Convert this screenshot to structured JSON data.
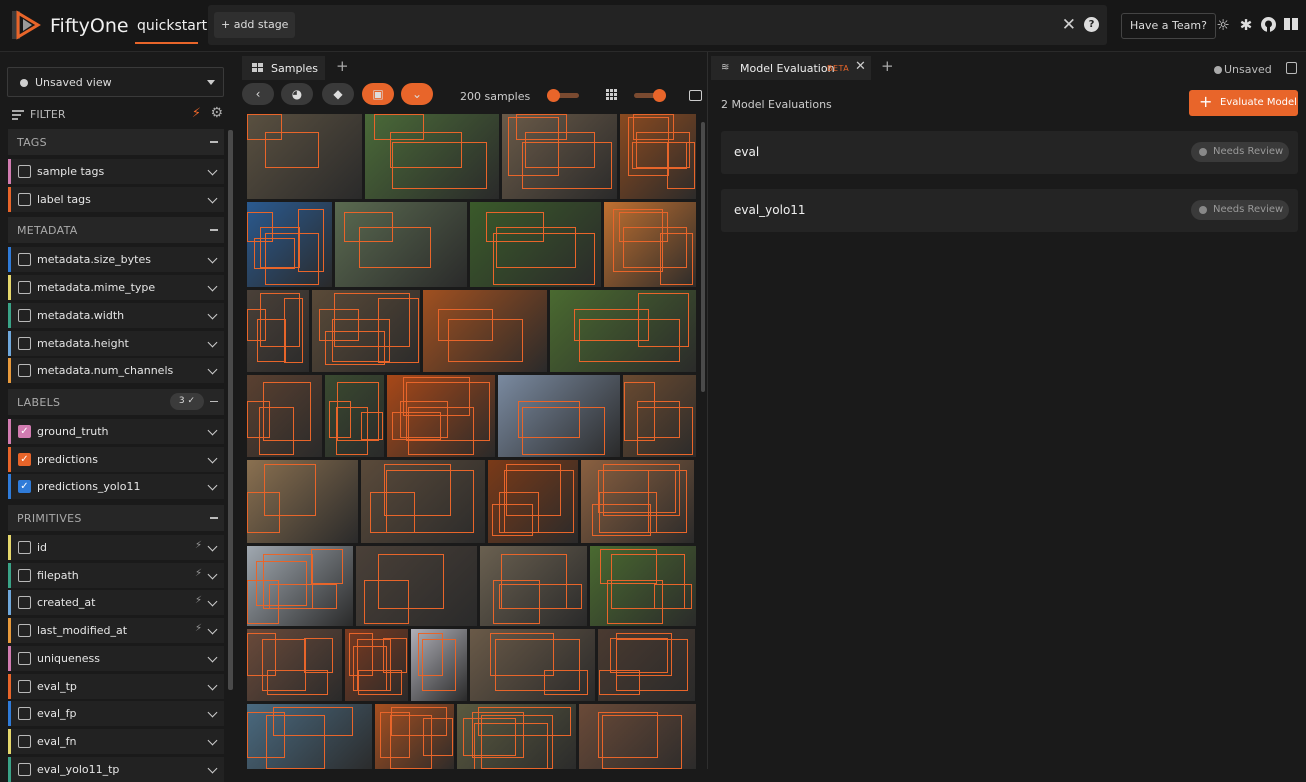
{
  "header": {
    "brand": "FiftyOne",
    "dataset": "quickstart",
    "add_stage": "+ add stage",
    "team_button": "Have a Team?",
    "icons": [
      "theme-icon",
      "slack-icon",
      "github-icon",
      "docs-icon"
    ]
  },
  "sidebar": {
    "view_select": "Unsaved view",
    "filter_label": "FILTER",
    "sections": [
      {
        "title": "TAGS",
        "fields": [
          {
            "label": "sample tags",
            "color": "#d27cb1",
            "checked": false,
            "bolt": false
          },
          {
            "label": "label tags",
            "color": "#e8652a",
            "checked": false,
            "bolt": false
          }
        ]
      },
      {
        "title": "METADATA",
        "fields": [
          {
            "label": "metadata.size_bytes",
            "color": "#2f7bd8",
            "checked": false,
            "bolt": false
          },
          {
            "label": "metadata.mime_type",
            "color": "#e6d86c",
            "checked": false,
            "bolt": false
          },
          {
            "label": "metadata.width",
            "color": "#3aa387",
            "checked": false,
            "bolt": false
          },
          {
            "label": "metadata.height",
            "color": "#6fa8dc",
            "checked": false,
            "bolt": false
          },
          {
            "label": "metadata.num_channels",
            "color": "#e89a3c",
            "checked": false,
            "bolt": false
          }
        ]
      },
      {
        "title": "LABELS",
        "badge": "3 ✓",
        "fields": [
          {
            "label": "ground_truth",
            "color": "#d27cb1",
            "checked": true,
            "bolt": false
          },
          {
            "label": "predictions",
            "color": "#e8652a",
            "checked": true,
            "bolt": false
          },
          {
            "label": "predictions_yolo11",
            "color": "#2f7bd8",
            "checked": true,
            "bolt": false
          }
        ]
      },
      {
        "title": "PRIMITIVES",
        "fields": [
          {
            "label": "id",
            "color": "#e6d86c",
            "checked": false,
            "bolt": true
          },
          {
            "label": "filepath",
            "color": "#3aa387",
            "checked": false,
            "bolt": true
          },
          {
            "label": "created_at",
            "color": "#6fa8dc",
            "checked": false,
            "bolt": true
          },
          {
            "label": "last_modified_at",
            "color": "#e89a3c",
            "checked": false,
            "bolt": true
          },
          {
            "label": "uniqueness",
            "color": "#d27cb1",
            "checked": false,
            "bolt": false
          },
          {
            "label": "eval_tp",
            "color": "#e8652a",
            "checked": false,
            "bolt": false
          },
          {
            "label": "eval_fp",
            "color": "#2f7bd8",
            "checked": false,
            "bolt": false
          },
          {
            "label": "eval_fn",
            "color": "#e6d86c",
            "checked": false,
            "bolt": false
          },
          {
            "label": "eval_yolo11_tp",
            "color": "#3aa387",
            "checked": false,
            "bolt": false
          }
        ]
      }
    ]
  },
  "samples_panel": {
    "tab_label": "Samples",
    "sample_count": "200 samples"
  },
  "eval_panel": {
    "tab_label": "Model Evaluation",
    "beta": "BETA",
    "unsaved": "Unsaved",
    "count_label": "2 Model Evaluations",
    "evaluate_button": "Evaluate Model",
    "evaluations": [
      {
        "name": "eval",
        "status": "Needs Review"
      },
      {
        "name": "eval_yolo11",
        "status": "Needs Review"
      }
    ]
  },
  "colors": {
    "accent": "#e8652a",
    "background": "#1a1a1a"
  }
}
